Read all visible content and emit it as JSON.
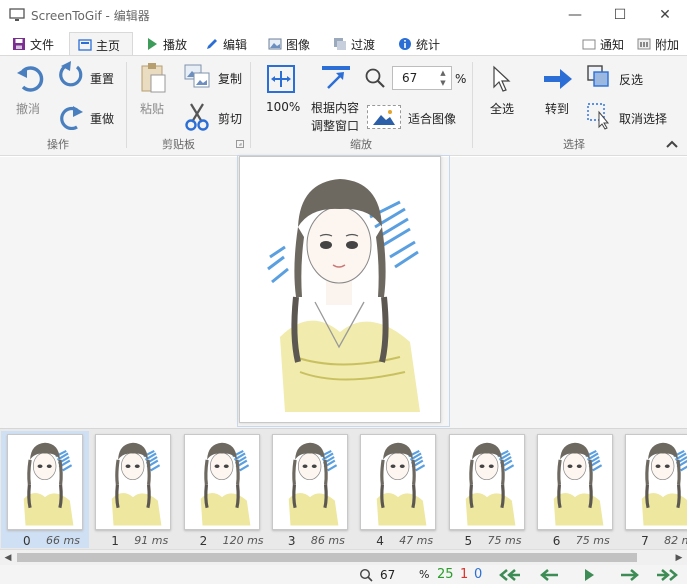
{
  "window": {
    "title": "ScreenToGif - 编辑器",
    "minimize_glyph": "—",
    "maximize_glyph": "☐",
    "close_glyph": "✕"
  },
  "tabs": [
    {
      "label": "文件",
      "icon": "save-icon"
    },
    {
      "label": "主页",
      "icon": "home-icon",
      "active": true
    },
    {
      "label": "播放",
      "icon": "play-icon"
    },
    {
      "label": "编辑",
      "icon": "pencil-icon"
    },
    {
      "label": "图像",
      "icon": "image-icon"
    },
    {
      "label": "过渡",
      "icon": "transition-icon"
    },
    {
      "label": "统计",
      "icon": "info-icon"
    }
  ],
  "header_right": {
    "notify_label": "通知",
    "extras_label": "附加"
  },
  "ribbon": {
    "undo": "撤消",
    "reset": "重置",
    "redo": "重做",
    "group_action": "操作",
    "paste": "粘贴",
    "copy": "复制",
    "cut": "剪切",
    "group_clipboard": "剪贴板",
    "zoom_100": "100%",
    "fit_content_line1": "根据内容",
    "fit_content_line2": "调整窗口",
    "zoom_value": "67",
    "zoom_percent": "%",
    "fit_image": "适合图像",
    "group_zoom": "缩放",
    "select_all": "全选",
    "go_to": "转到",
    "invert": "反选",
    "deselect": "取消选择",
    "group_select": "选择"
  },
  "frames": [
    {
      "index": "0",
      "delay": "66 ms",
      "selected": true
    },
    {
      "index": "1",
      "delay": "91 ms"
    },
    {
      "index": "2",
      "delay": "120 ms"
    },
    {
      "index": "3",
      "delay": "86 ms"
    },
    {
      "index": "4",
      "delay": "47 ms"
    },
    {
      "index": "5",
      "delay": "75 ms"
    },
    {
      "index": "6",
      "delay": "75 ms"
    },
    {
      "index": "7",
      "delay": "82 m"
    }
  ],
  "status": {
    "zoom_value": "67",
    "zoom_percent": "%",
    "total_frames": "25",
    "selected_frames": "1",
    "current_frame": "0"
  },
  "colors": {
    "accent_blue": "#2b7bd6",
    "status_green": "#2a9d2a",
    "status_red": "#d9342b",
    "status_blue": "#2b6fd6",
    "nav_green": "#3d8c56"
  }
}
